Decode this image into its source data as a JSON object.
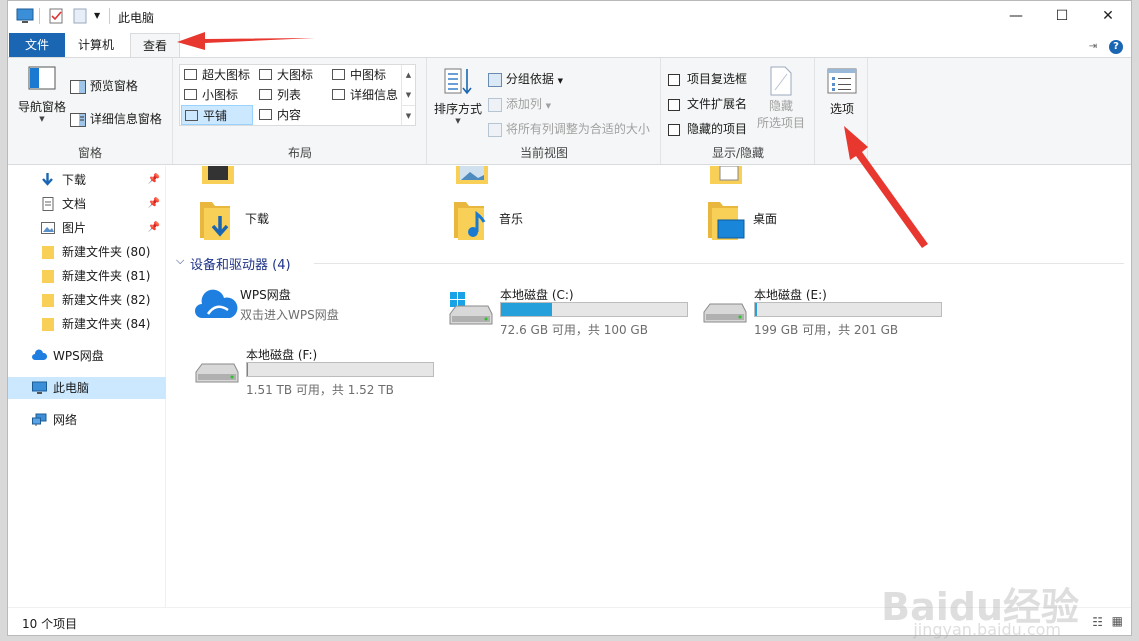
{
  "window": {
    "title": "此电脑"
  },
  "tabs": {
    "file": "文件",
    "computer": "计算机",
    "view": "查看"
  },
  "ribbon": {
    "panes": {
      "label": "窗格",
      "nav_pane": "导航窗格",
      "preview_pane": "预览窗格",
      "details_pane": "详细信息窗格"
    },
    "layout": {
      "label": "布局",
      "items": [
        "超大图标",
        "大图标",
        "中图标",
        "小图标",
        "列表",
        "详细信息",
        "平铺",
        "内容"
      ]
    },
    "current_view": {
      "label": "当前视图",
      "sort_by": "排序方式",
      "group_by": "分组依据",
      "add_column": "添加列",
      "size_all_columns": "将所有列调整为合适的大小"
    },
    "show_hide": {
      "label": "显示/隐藏",
      "item_checkboxes": "项目复选框",
      "file_extensions": "文件扩展名",
      "hidden_items": "隐藏的项目",
      "hide_selected_1": "隐藏",
      "hide_selected_2": "所选项目"
    },
    "options": "选项"
  },
  "nav": {
    "items": [
      {
        "label": "下载",
        "pinned": true
      },
      {
        "label": "文档",
        "pinned": true
      },
      {
        "label": "图片",
        "pinned": true
      },
      {
        "label": "新建文件夹 (80)",
        "pinned": false
      },
      {
        "label": "新建文件夹 (81)",
        "pinned": false
      },
      {
        "label": "新建文件夹 (82)",
        "pinned": false
      },
      {
        "label": "新建文件夹 (84)",
        "pinned": false
      },
      {
        "label": "WPS网盘",
        "pinned": false
      },
      {
        "label": "此电脑",
        "pinned": false
      },
      {
        "label": "网络",
        "pinned": false
      }
    ]
  },
  "content": {
    "folders": [
      {
        "name": "下载"
      },
      {
        "name": "音乐"
      },
      {
        "name": "桌面"
      }
    ],
    "devices_header": "设备和驱动器 (4)",
    "wps": {
      "name": "WPS网盘",
      "sub": "双击进入WPS网盘"
    },
    "drives": [
      {
        "name": "本地磁盘 (C:)",
        "info": "72.6 GB 可用，共 100 GB",
        "used_fraction": 0.274
      },
      {
        "name": "本地磁盘 (E:)",
        "info": "199 GB 可用，共 201 GB",
        "used_fraction": 0.01
      },
      {
        "name": "本地磁盘 (F:)",
        "info": "1.51 TB 可用，共 1.52 TB",
        "used_fraction": 0.007
      }
    ]
  },
  "status": {
    "item_count": "10 个项目"
  },
  "colors": {
    "accent": "#1a66b3",
    "drive_fill": "#26a0da",
    "annotation": "#e8372f"
  },
  "watermark": {
    "main": "Baidu经验",
    "sub": "jingyan.baidu.com"
  }
}
